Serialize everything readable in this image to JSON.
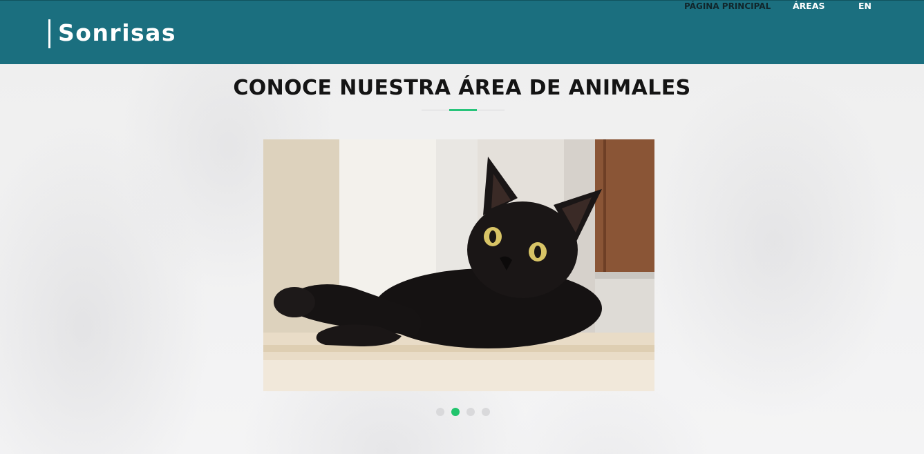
{
  "header": {
    "brand": "Sonrisas",
    "nav": {
      "home": "PÁGINA PRINCIPAL",
      "areas": "ÁREAS",
      "language": "EN"
    },
    "bg_color": "#1b6f7f"
  },
  "main": {
    "title": "CONOCE NUESTRA ÁREA DE ANIMALES",
    "accent_color": "#27c47a",
    "carousel": {
      "current_slide": 2,
      "total_slides": 4,
      "slide_image": "black-cat-photo"
    }
  }
}
